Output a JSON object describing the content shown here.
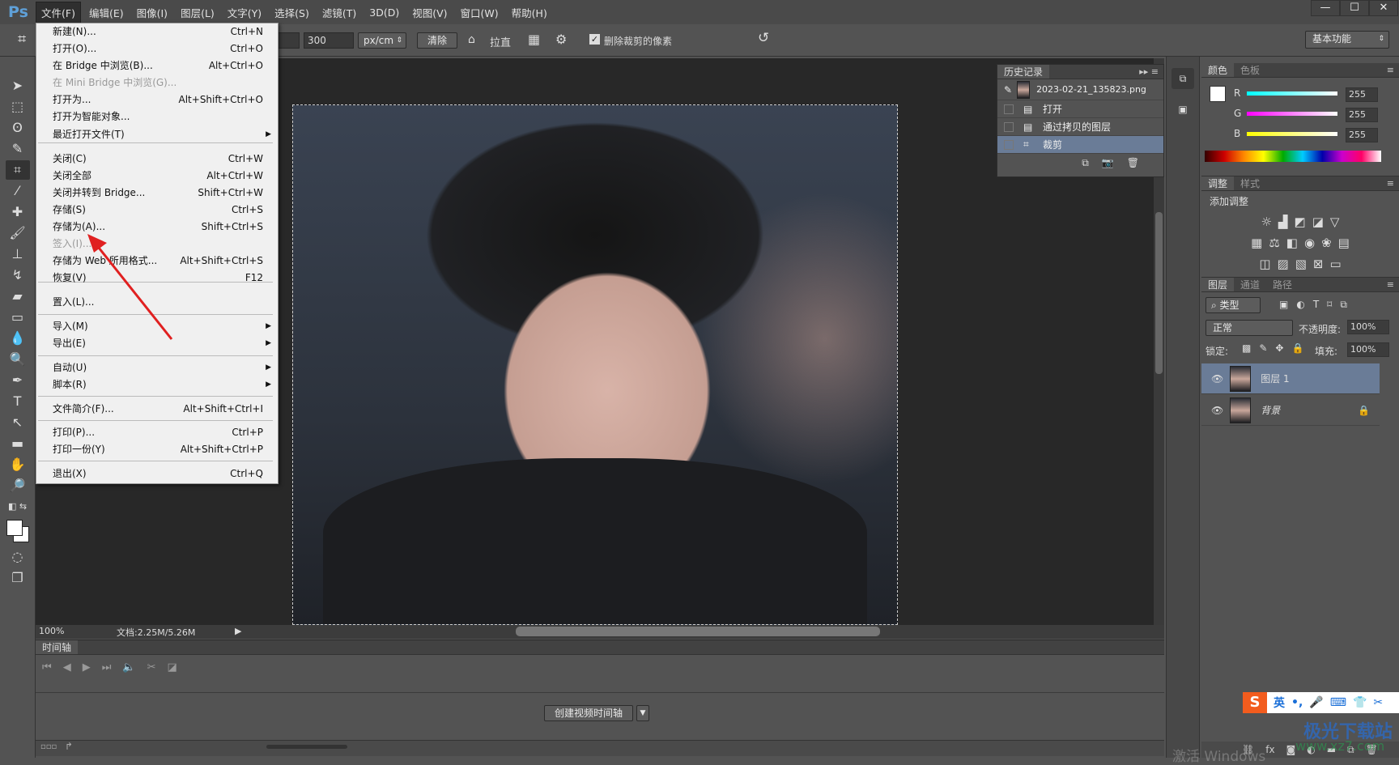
{
  "app": {
    "logo": "Ps"
  },
  "menubar": {
    "items": [
      "文件(F)",
      "编辑(E)",
      "图像(I)",
      "图层(L)",
      "文字(Y)",
      "选择(S)",
      "滤镜(T)",
      "3D(D)",
      "视图(V)",
      "窗口(W)",
      "帮助(H)"
    ],
    "active": "文件(F)"
  },
  "window_controls": {
    "minimize": "—",
    "maximize": "☐",
    "close": "✕"
  },
  "options": {
    "resolution": "300",
    "unit": "px/cm",
    "clear_label": "清除",
    "straighten_label": "拉直",
    "delete_cropped_label": "删除裁剪的像素",
    "delete_cropped_checked": true,
    "workspace": "基本功能"
  },
  "file_menu": {
    "items": [
      {
        "label": "新建(N)...",
        "shortcut": "Ctrl+N"
      },
      {
        "label": "打开(O)...",
        "shortcut": "Ctrl+O"
      },
      {
        "label": "在 Bridge 中浏览(B)...",
        "shortcut": "Alt+Ctrl+O"
      },
      {
        "label": "在 Mini Bridge 中浏览(G)...",
        "shortcut": "",
        "disabled": true
      },
      {
        "label": "打开为...",
        "shortcut": "Alt+Shift+Ctrl+O"
      },
      {
        "label": "打开为智能对象...",
        "shortcut": ""
      },
      {
        "label": "最近打开文件(T)",
        "shortcut": "",
        "submenu": true
      },
      {
        "label": "关闭(C)",
        "shortcut": "Ctrl+W"
      },
      {
        "label": "关闭全部",
        "shortcut": "Alt+Ctrl+W"
      },
      {
        "label": "关闭并转到 Bridge...",
        "shortcut": "Shift+Ctrl+W"
      },
      {
        "label": "存储(S)",
        "shortcut": "Ctrl+S"
      },
      {
        "label": "存储为(A)...",
        "shortcut": "Shift+Ctrl+S"
      },
      {
        "label": "签入(I)...",
        "shortcut": "",
        "disabled": true
      },
      {
        "label": "存储为 Web 所用格式...",
        "shortcut": "Alt+Shift+Ctrl+S"
      },
      {
        "label": "恢复(V)",
        "shortcut": "F12"
      },
      {
        "label": "置入(L)...",
        "shortcut": ""
      },
      {
        "label": "导入(M)",
        "shortcut": "",
        "submenu": true
      },
      {
        "label": "导出(E)",
        "shortcut": "",
        "submenu": true
      },
      {
        "label": "自动(U)",
        "shortcut": "",
        "submenu": true
      },
      {
        "label": "脚本(R)",
        "shortcut": "",
        "submenu": true
      },
      {
        "label": "文件简介(F)...",
        "shortcut": "Alt+Shift+Ctrl+I"
      },
      {
        "label": "打印(P)...",
        "shortcut": "Ctrl+P"
      },
      {
        "label": "打印一份(Y)",
        "shortcut": "Alt+Shift+Ctrl+P"
      },
      {
        "label": "退出(X)",
        "shortcut": "Ctrl+Q"
      }
    ]
  },
  "status": {
    "zoom": "100%",
    "doc": "文档:2.25M/5.26M"
  },
  "timeline": {
    "tab": "时间轴",
    "create_button": "创建视频时间轴"
  },
  "history": {
    "tab": "历史记录",
    "snapshot": "2023-02-21_135823.png",
    "items": [
      "打开",
      "通过拷贝的图层",
      "裁剪"
    ],
    "selected": "裁剪"
  },
  "color": {
    "tabs": [
      "颜色",
      "色板"
    ],
    "r": "255",
    "g": "255",
    "b": "255",
    "labels": [
      "R",
      "G",
      "B"
    ]
  },
  "adjustments": {
    "tabs": [
      "调整",
      "样式"
    ],
    "title": "添加调整"
  },
  "layers": {
    "tabs": [
      "图层",
      "通道",
      "路径"
    ],
    "filter": "类型",
    "blend": "正常",
    "opacity_label": "不透明度:",
    "opacity": "100%",
    "lock_label": "锁定:",
    "fill_label": "填充:",
    "fill": "100%",
    "items": [
      {
        "name": "图层 1",
        "selected": true
      },
      {
        "name": "背景",
        "locked": true
      }
    ]
  },
  "ime": {
    "lang": "英"
  },
  "watermark": {
    "site": "极光下载站",
    "url": "www.xz7.com",
    "activate": "激活 Windows"
  },
  "colors": {
    "accent": "#6a7c97",
    "arrow": "#e02020",
    "panel": "#535353",
    "canvas": "#282828"
  }
}
